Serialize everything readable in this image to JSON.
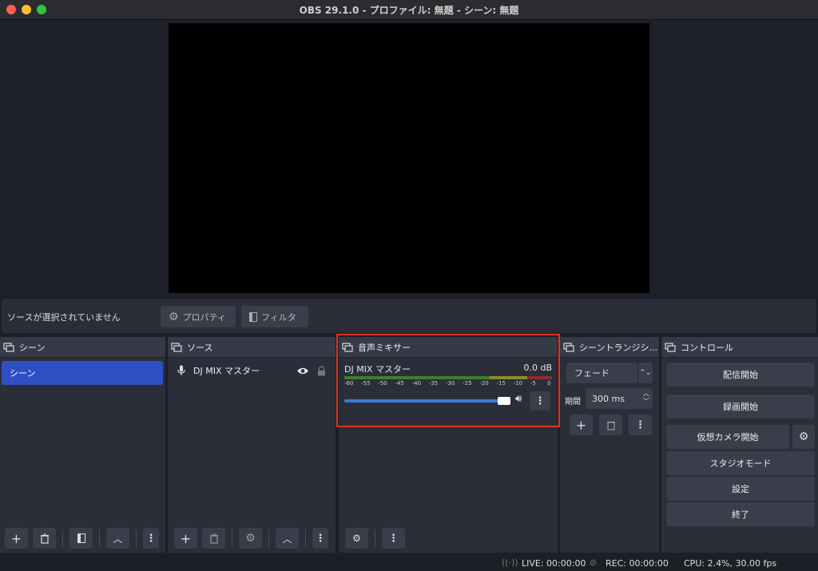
{
  "window": {
    "title": "OBS 29.1.0 - プロファイル: 無題 - シーン: 無題",
    "traffic_colors": [
      "#fe5f57",
      "#febc2e",
      "#28c840"
    ]
  },
  "context_bar": {
    "no_source_label": "ソースが選択されていません",
    "properties_label": "プロパティ",
    "filters_label": "フィルタ"
  },
  "scenes": {
    "title": "シーン",
    "items": [
      "シーン"
    ]
  },
  "sources": {
    "title": "ソース",
    "items": [
      {
        "name": "DJ MIX マスター",
        "icon": "microphone-icon"
      }
    ]
  },
  "mixer": {
    "title": "音声ミキサー",
    "channel_name": "DJ MIX マスター",
    "level": "0.0 dB",
    "scale": [
      "-60",
      "-55",
      "-50",
      "-45",
      "-40",
      "-35",
      "-30",
      "-25",
      "-20",
      "-15",
      "-10",
      "-5",
      "0"
    ],
    "volume_fraction": 1.0
  },
  "transitions": {
    "title": "シーントランジシ...",
    "selected": "フェード",
    "duration_label": "期間",
    "duration_value": "300 ms"
  },
  "controls": {
    "title": "コントロール",
    "start_streaming": "配信開始",
    "start_recording": "録画開始",
    "start_virtual_camera": "仮想カメラ開始",
    "studio_mode": "スタジオモード",
    "settings": "設定",
    "exit": "終了"
  },
  "status": {
    "live": "LIVE: 00:00:00",
    "rec": "REC: 00:00:00",
    "cpu": "CPU: 2.4%, 30.00 fps"
  },
  "colors": {
    "accent_blue": "#2f50c4",
    "highlight_red": "#e03420"
  }
}
